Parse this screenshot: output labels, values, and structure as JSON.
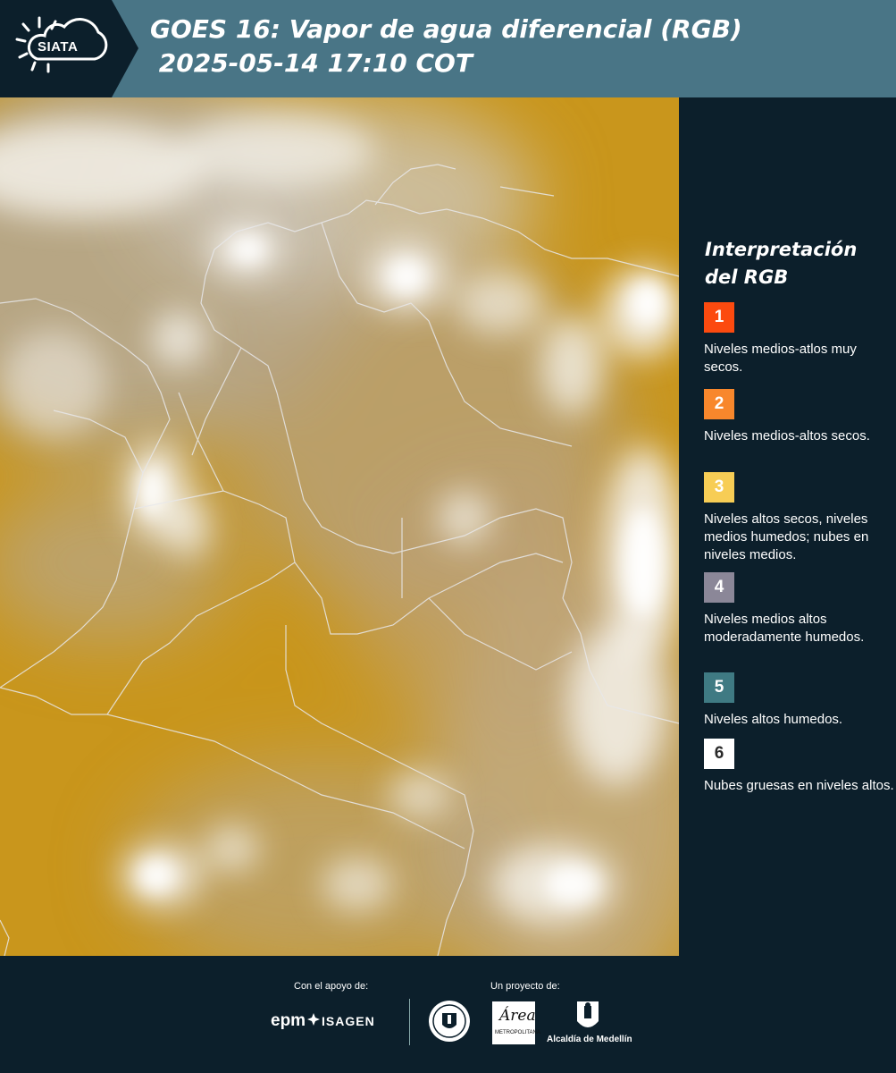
{
  "header": {
    "logo_label": "SIATA",
    "title": "GOES 16: Vapor de agua diferencial (RGB)\n 2025-05-14 17:10 COT"
  },
  "colors": {
    "header_bg": "#497586",
    "dark_bg": "#0c1f2b",
    "map_base": "#c7951d"
  },
  "legend": {
    "title": "Interpretación del RGB",
    "items": [
      {
        "num": "1",
        "color": "#fc4a0f",
        "text_color": "#ffffff",
        "desc": "Niveles medios-atlos muy secos."
      },
      {
        "num": "2",
        "color": "#f8872c",
        "text_color": "#ffffff",
        "desc": "Niveles medios-altos secos."
      },
      {
        "num": "3",
        "color": "#f7cd55",
        "text_color": "#ffffff",
        "desc": "Niveles altos secos, niveles medios humedos; nubes en niveles medios."
      },
      {
        "num": "4",
        "color": "#8b8798",
        "text_color": "#ffffff",
        "desc": "Niveles medios altos moderadamente humedos."
      },
      {
        "num": "5",
        "color": "#3f7a83",
        "text_color": "#ffffff",
        "desc": "Niveles altos humedos."
      },
      {
        "num": "6",
        "color": "#ffffff",
        "text_color": "#2a2a2a",
        "desc": "Nubes gruesas en niveles altos."
      }
    ]
  },
  "footer": {
    "support_label": "Con el apoyo de:",
    "project_label": "Un proyecto de:",
    "epm": "epm",
    "isagen": "ISAGEN",
    "area_name": "Área",
    "area_sub": "METROPOLITANA",
    "alcaldia": "Alcaldía de Medellín"
  }
}
